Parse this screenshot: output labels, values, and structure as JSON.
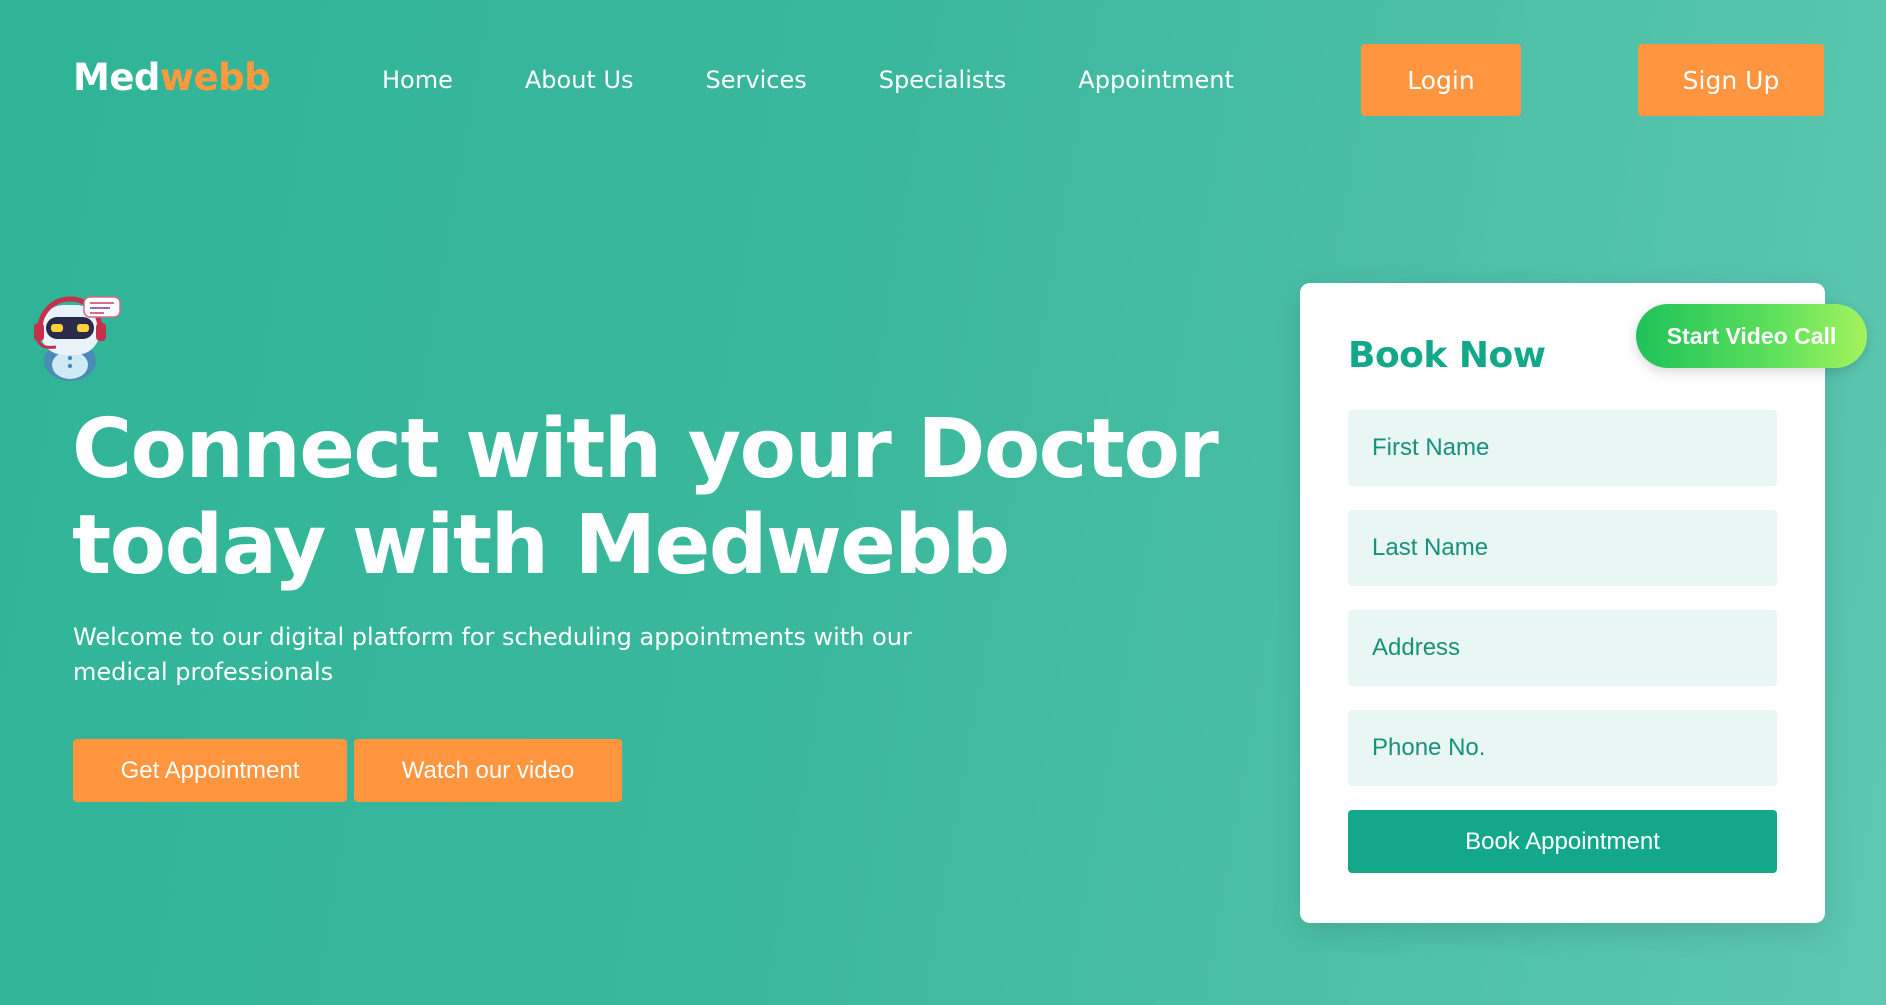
{
  "brand": {
    "name_part_a": "Med",
    "name_part_b": "webb",
    "accent_color": "#ff953e",
    "primary_color": "#13a88a"
  },
  "nav": {
    "links": [
      {
        "label": "Home"
      },
      {
        "label": "About Us"
      },
      {
        "label": "Services"
      },
      {
        "label": "Specialists"
      },
      {
        "label": "Appointment"
      }
    ],
    "login_label": "Login",
    "signup_label": "Sign Up"
  },
  "chatbot": {
    "icon": "robot-assistant-icon"
  },
  "hero": {
    "title_line_1": "Connect with your Doctor",
    "title_line_2": "today with Medwebb",
    "subtitle_line_1": "Welcome to our digital platform for scheduling appointments with our",
    "subtitle_line_2": "medical professionals",
    "get_appointment_label": "Get Appointment",
    "watch_video_label": "Watch our video"
  },
  "booking": {
    "title": "Book Now",
    "video_call_label": "Start Video Call",
    "fields": {
      "first_name_placeholder": "First Name",
      "last_name_placeholder": "Last Name",
      "address_placeholder": "Address",
      "phone_placeholder": "Phone No."
    },
    "submit_label": "Book Appointment"
  }
}
